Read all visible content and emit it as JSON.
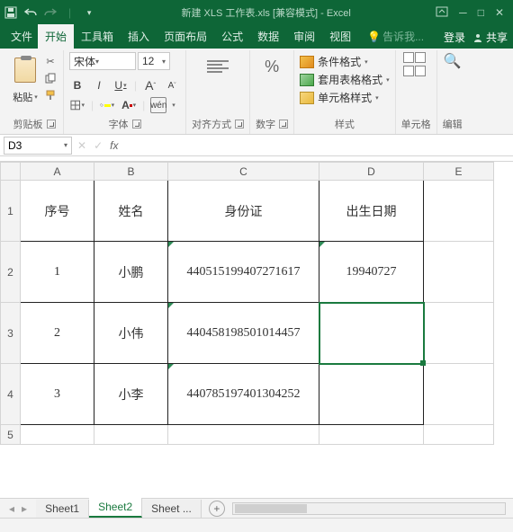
{
  "title": {
    "file": "新建 XLS 工作表.xls",
    "compat": "[兼容模式]",
    "app": "Excel"
  },
  "tabs": {
    "file": "文件",
    "home": "开始",
    "toolbox": "工具箱",
    "insert": "插入",
    "pageLayout": "页面布局",
    "formulas": "公式",
    "data": "数据",
    "review": "审阅",
    "view": "视图",
    "tellMe": "告诉我...",
    "login": "登录",
    "share": "共享"
  },
  "ribbon": {
    "clipboard": {
      "paste": "粘贴",
      "label": "剪贴板"
    },
    "font": {
      "name": "宋体",
      "size": "12",
      "b": "B",
      "i": "I",
      "u": "U",
      "a_up": "A",
      "a_dn": "A",
      "wen": "wén",
      "label": "字体"
    },
    "align": {
      "label": "对齐方式"
    },
    "number": {
      "sym": "%",
      "label": "数字"
    },
    "styles": {
      "cond": "条件格式",
      "table": "套用表格格式",
      "cell": "单元格样式",
      "label": "样式"
    },
    "cells": {
      "label": "单元格"
    },
    "editing": {
      "label": "编辑"
    }
  },
  "nameBox": "D3",
  "fx": "fx",
  "columns": [
    "A",
    "B",
    "C",
    "D",
    "E"
  ],
  "rows": [
    "1",
    "2",
    "3",
    "4",
    "5"
  ],
  "header": {
    "seq": "序号",
    "name": "姓名",
    "id": "身份证",
    "dob": "出生日期"
  },
  "dataRows": [
    {
      "seq": "1",
      "name": "小鹏",
      "id": "440515199407271617",
      "dob": "19940727"
    },
    {
      "seq": "2",
      "name": "小伟",
      "id": "440458198501014457",
      "dob": ""
    },
    {
      "seq": "3",
      "name": "小李",
      "id": "440785197401304252",
      "dob": ""
    }
  ],
  "sheets": {
    "s1": "Sheet1",
    "s2": "Sheet2",
    "s3": "Sheet ..."
  }
}
